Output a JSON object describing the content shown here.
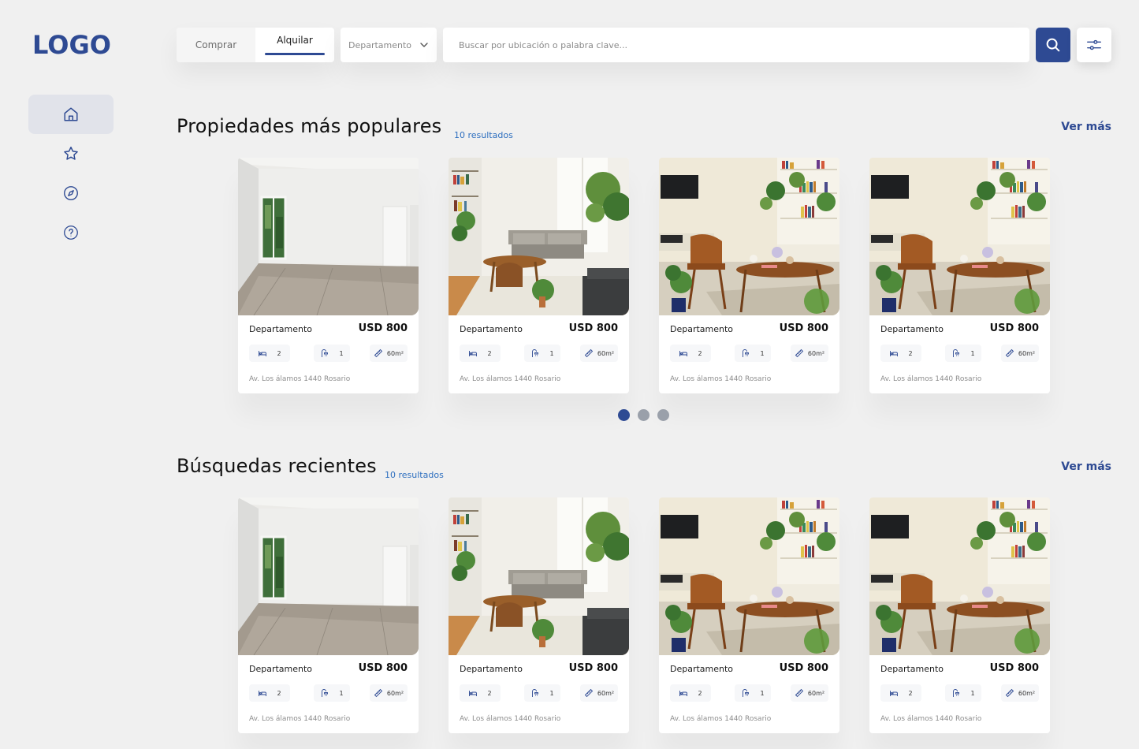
{
  "sidebar": {
    "logo": "LOGO",
    "items": [
      {
        "icon": "home-icon",
        "active": true
      },
      {
        "icon": "star-icon",
        "active": false
      },
      {
        "icon": "compass-icon",
        "active": false
      },
      {
        "icon": "help-icon",
        "active": false
      }
    ]
  },
  "search": {
    "tabs": [
      "Comprar",
      "Alquilar"
    ],
    "active_tab": "Alquilar",
    "type_value": "Departamento",
    "placeholder": "Buscar por ubicación o palabra clave..."
  },
  "colors": {
    "accent": "#2e4a93",
    "link": "#2e6fbf"
  },
  "sections": [
    {
      "title": "Propiedades más populares",
      "results": "10 resultados",
      "ver_mas": "Ver más",
      "cards": [
        {
          "type": "Departamento",
          "price": "USD 800",
          "beds": "2",
          "baths": "1",
          "area": "60m²",
          "address": "Av. Los álamos 1440 Rosario",
          "photo": "empty-room"
        },
        {
          "type": "Departamento",
          "price": "USD 800",
          "beds": "2",
          "baths": "1",
          "area": "60m²",
          "address": "Av. Los álamos 1440 Rosario",
          "photo": "living-room"
        },
        {
          "type": "Departamento",
          "price": "USD 800",
          "beds": "2",
          "baths": "1",
          "area": "60m²",
          "address": "Av. Los álamos 1440 Rosario",
          "photo": "dining-room"
        },
        {
          "type": "Departamento",
          "price": "USD 800",
          "beds": "2",
          "baths": "1",
          "area": "60m²",
          "address": "Av. Los álamos 1440 Rosario",
          "photo": "dining-room"
        }
      ],
      "carousel": {
        "pages": 3,
        "current": 1
      }
    },
    {
      "title": "Búsquedas recientes",
      "results": "10 resultados",
      "ver_mas": "Ver más",
      "cards": [
        {
          "type": "Departamento",
          "price": "USD 800",
          "beds": "2",
          "baths": "1",
          "area": "60m²",
          "address": "Av. Los álamos 1440 Rosario",
          "photo": "empty-room"
        },
        {
          "type": "Departamento",
          "price": "USD 800",
          "beds": "2",
          "baths": "1",
          "area": "60m²",
          "address": "Av. Los álamos 1440 Rosario",
          "photo": "living-room"
        },
        {
          "type": "Departamento",
          "price": "USD 800",
          "beds": "2",
          "baths": "1",
          "area": "60m²",
          "address": "Av. Los álamos 1440 Rosario",
          "photo": "dining-room"
        },
        {
          "type": "Departamento",
          "price": "USD 800",
          "beds": "2",
          "baths": "1",
          "area": "60m²",
          "address": "Av. Los álamos 1440 Rosario",
          "photo": "dining-room"
        }
      ]
    }
  ]
}
